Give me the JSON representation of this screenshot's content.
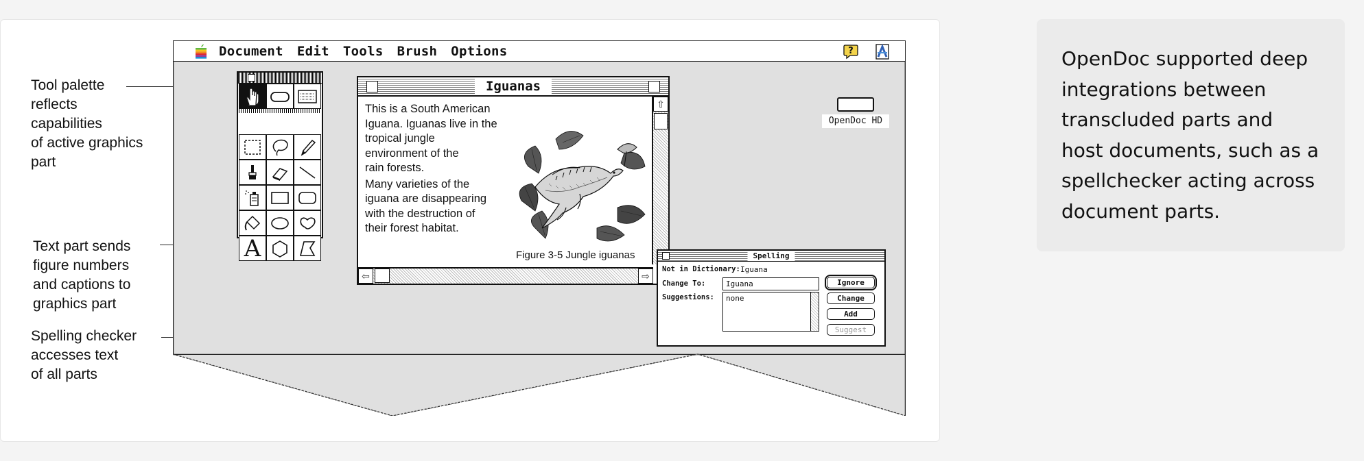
{
  "caption": {
    "text": "OpenDoc supported deep integrations between transcluded parts and host documents, such as a spellchecker acting across document parts."
  },
  "annotations": [
    {
      "lines": [
        "Tool palette",
        "reflects",
        "capabilities",
        "of active graphics",
        "part"
      ]
    },
    {
      "lines": [
        "Text part sends",
        "figure numbers",
        "and captions to",
        "graphics part"
      ]
    },
    {
      "lines": [
        "Spelling checker",
        "accesses text",
        "of all parts"
      ]
    }
  ],
  "menubar": {
    "items": [
      "Document",
      "Edit",
      "Tools",
      "Brush",
      "Options"
    ],
    "icons": [
      "apple-icon",
      "help-icon",
      "application-icon"
    ]
  },
  "desktop": {
    "disk_label": "OpenDoc HD"
  },
  "palette": {
    "tools": [
      "hand",
      "rounded-rect-select",
      "marquee-grid",
      "rect-select",
      "lasso",
      "pencil",
      "brush",
      "eraser",
      "line",
      "spray-can",
      "rectangle",
      "rounded-rectangle",
      "paint-bucket",
      "oval",
      "freeform-shape",
      "text",
      "polygon",
      "free-polygon"
    ],
    "text_tool_glyph": "A"
  },
  "document": {
    "title": "Iguanas",
    "paragraph1": [
      "This is a South American",
      "Iguana. Iguanas  live in the",
      "tropical jungle",
      "environment of the",
      "rain forests."
    ],
    "paragraph2": [
      "Many varieties of the",
      "iguana are disappearing",
      "with the destruction of",
      "their forest habitat."
    ],
    "figure_caption": "Figure 3-5 Jungle iguanas"
  },
  "spelling": {
    "title": "Spelling",
    "not_in_dictionary_label": "Not in Dictionary:",
    "not_in_dictionary_value": "Iguana",
    "change_to_label": "Change To:",
    "change_to_value": "Iguana",
    "suggestions_label": "Suggestions:",
    "suggestions_value": "none",
    "buttons": {
      "ignore": "Ignore",
      "change": "Change",
      "add": "Add",
      "suggest": "Suggest"
    }
  }
}
